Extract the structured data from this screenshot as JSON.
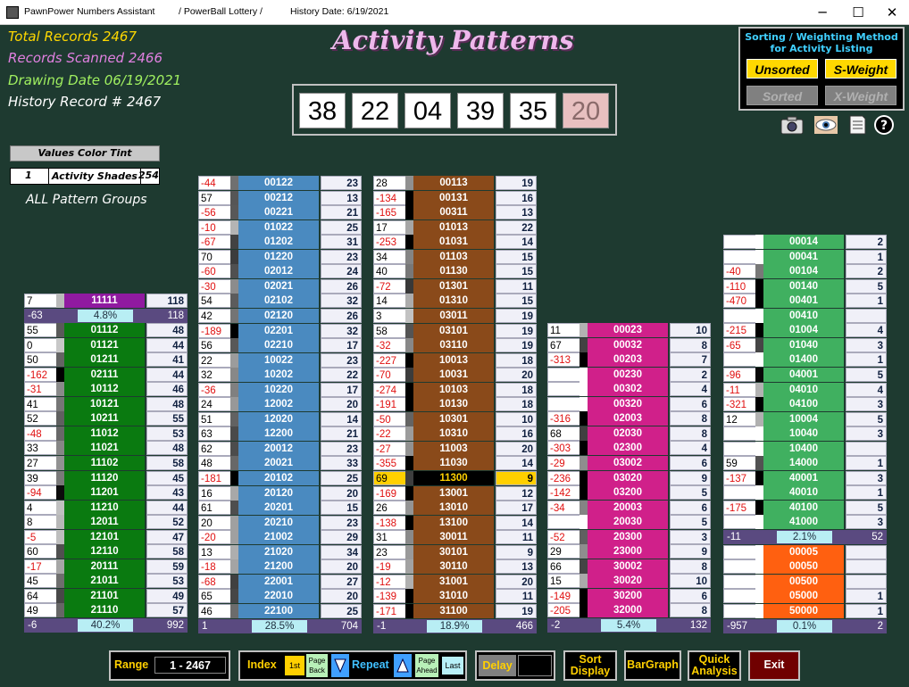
{
  "window": {
    "app": "PawnPower Numbers Assistant",
    "game": "/ PowerBall Lottery /",
    "history": "History Date:  6/19/2021",
    "minimize": "─",
    "maximize": "☐",
    "close": "✕"
  },
  "stats": {
    "total": "Total Records    2467",
    "scanned": "Records Scanned    2466",
    "drawing": "Drawing Date   06/19/2021",
    "history": "History Record #   2467"
  },
  "page_title": "Activity Patterns",
  "drawing": {
    "balls": [
      "38",
      "22",
      "04",
      "39",
      "35"
    ],
    "powerball": "20"
  },
  "sorting": {
    "header": "Sorting / Weighting Method for Activity Listing",
    "unsorted": "Unsorted",
    "sweight": "S-Weight",
    "sorted": "Sorted",
    "xweight": "X-Weight"
  },
  "tools": {
    "camera": "camera-icon",
    "eye": "eye-icon",
    "document": "document-icon",
    "help": "help-icon"
  },
  "tint": {
    "button": "Values Color Tint",
    "min": "1",
    "label": "Activity Shades",
    "max": "254"
  },
  "all_groups": "ALL Pattern Groups",
  "groups": [
    {
      "color": "#0a7a10",
      "header": {
        "l": "7",
        "m": "11111",
        "r": "118"
      },
      "headsum": {
        "l": "-63",
        "pct": "4.8%",
        "r": "118"
      },
      "rows": [
        [
          "55",
          "01112",
          "48"
        ],
        [
          "0",
          "01121",
          "44"
        ],
        [
          "50",
          "01211",
          "41"
        ],
        [
          "-162",
          "02111",
          "44"
        ],
        [
          "-31",
          "10112",
          "46"
        ],
        [
          "41",
          "10121",
          "48"
        ],
        [
          "52",
          "10211",
          "55"
        ],
        [
          "-48",
          "11012",
          "53"
        ],
        [
          "33",
          "11021",
          "48"
        ],
        [
          "27",
          "11102",
          "58"
        ],
        [
          "39",
          "11120",
          "45"
        ],
        [
          "-94",
          "11201",
          "43"
        ],
        [
          "4",
          "11210",
          "44"
        ],
        [
          "8",
          "12011",
          "52"
        ],
        [
          "-5",
          "12101",
          "47"
        ],
        [
          "60",
          "12110",
          "58"
        ],
        [
          "-17",
          "20111",
          "59"
        ],
        [
          "45",
          "21011",
          "53"
        ],
        [
          "64",
          "21101",
          "49"
        ],
        [
          "49",
          "21110",
          "57"
        ]
      ],
      "sum": {
        "l": "-6",
        "pct": "40.2%",
        "r": "992"
      }
    },
    {
      "color": "#4a8ac0",
      "rows": [
        [
          "-44",
          "00122",
          "23"
        ],
        [
          "57",
          "00212",
          "13"
        ],
        [
          "-56",
          "00221",
          "21"
        ],
        [
          "-10",
          "01022",
          "25"
        ],
        [
          "-67",
          "01202",
          "31"
        ],
        [
          "70",
          "01220",
          "23"
        ],
        [
          "-60",
          "02012",
          "24"
        ],
        [
          "-30",
          "02021",
          "26"
        ],
        [
          "54",
          "02102",
          "32"
        ],
        [
          "42",
          "02120",
          "26"
        ],
        [
          "-189",
          "02201",
          "32"
        ],
        [
          "56",
          "02210",
          "17"
        ],
        [
          "22",
          "10022",
          "23"
        ],
        [
          "32",
          "10202",
          "22"
        ],
        [
          "-36",
          "10220",
          "17"
        ],
        [
          "24",
          "12002",
          "20"
        ],
        [
          "51",
          "12020",
          "14"
        ],
        [
          "63",
          "12200",
          "21"
        ],
        [
          "62",
          "20012",
          "23"
        ],
        [
          "48",
          "20021",
          "33"
        ],
        [
          "-181",
          "20102",
          "25"
        ],
        [
          "16",
          "20120",
          "20"
        ],
        [
          "61",
          "20201",
          "15"
        ],
        [
          "20",
          "20210",
          "23"
        ],
        [
          "-20",
          "21002",
          "29"
        ],
        [
          "13",
          "21020",
          "34"
        ],
        [
          "-18",
          "21200",
          "20"
        ],
        [
          "-68",
          "22001",
          "27"
        ],
        [
          "65",
          "22010",
          "20"
        ],
        [
          "46",
          "22100",
          "25"
        ]
      ],
      "sum": {
        "l": "1",
        "pct": "28.5%",
        "r": "704"
      }
    },
    {
      "color": "#8a4a1a",
      "rows": [
        [
          "28",
          "00113",
          "19"
        ],
        [
          "-134",
          "00131",
          "16"
        ],
        [
          "-165",
          "00311",
          "13"
        ],
        [
          "17",
          "01013",
          "22"
        ],
        [
          "-253",
          "01031",
          "14"
        ],
        [
          "34",
          "01103",
          "15"
        ],
        [
          "40",
          "01130",
          "15"
        ],
        [
          "-72",
          "01301",
          "11"
        ],
        [
          "14",
          "01310",
          "15"
        ],
        [
          "3",
          "03011",
          "19"
        ],
        [
          "58",
          "03101",
          "19"
        ],
        [
          "-32",
          "03110",
          "19"
        ],
        [
          "-227",
          "10013",
          "18"
        ],
        [
          "-70",
          "10031",
          "20"
        ],
        [
          "-274",
          "10103",
          "18"
        ],
        [
          "-191",
          "10130",
          "18"
        ],
        [
          "-50",
          "10301",
          "10"
        ],
        [
          "-22",
          "10310",
          "16"
        ],
        [
          "-27",
          "11003",
          "20"
        ],
        [
          "-355",
          "11030",
          "14"
        ],
        [
          "69",
          "11300",
          "9"
        ],
        [
          "-169",
          "13001",
          "12"
        ],
        [
          "26",
          "13010",
          "17"
        ],
        [
          "-138",
          "13100",
          "14"
        ],
        [
          "31",
          "30011",
          "11"
        ],
        [
          "23",
          "30101",
          "9"
        ],
        [
          "-19",
          "30110",
          "13"
        ],
        [
          "-12",
          "31001",
          "20"
        ],
        [
          "-139",
          "31010",
          "11"
        ],
        [
          "-171",
          "31100",
          "19"
        ]
      ],
      "sum": {
        "l": "-1",
        "pct": "18.9%",
        "r": "466"
      }
    },
    {
      "color": "#d0208a",
      "rows": [
        [
          "11",
          "00023",
          "10"
        ],
        [
          "67",
          "00032",
          "8"
        ],
        [
          "-313",
          "00203",
          "7"
        ],
        [
          "",
          "00230",
          "2"
        ],
        [
          "",
          "00302",
          "4"
        ],
        [
          "",
          "00320",
          "6"
        ],
        [
          "-316",
          "02003",
          "8"
        ],
        [
          "68",
          "02030",
          "8"
        ],
        [
          "-303",
          "02300",
          "4"
        ],
        [
          "-29",
          "03002",
          "6"
        ],
        [
          "-236",
          "03020",
          "9"
        ],
        [
          "-142",
          "03200",
          "5"
        ],
        [
          "-34",
          "20003",
          "6"
        ],
        [
          "",
          "20030",
          "5"
        ],
        [
          "-52",
          "20300",
          "3"
        ],
        [
          "29",
          "23000",
          "9"
        ],
        [
          "66",
          "30002",
          "8"
        ],
        [
          "15",
          "30020",
          "10"
        ],
        [
          "-149",
          "30200",
          "6"
        ],
        [
          "-205",
          "32000",
          "8"
        ]
      ],
      "sum": {
        "l": "-2",
        "pct": "5.4%",
        "r": "132"
      }
    },
    {
      "color": "#40b060",
      "rows": [
        [
          "",
          "00014",
          "2"
        ],
        [
          "",
          "00041",
          "1"
        ],
        [
          "-40",
          "00104",
          "2"
        ],
        [
          "-110",
          "00140",
          "5"
        ],
        [
          "-470",
          "00401",
          "1"
        ],
        [
          "",
          "00410",
          ""
        ],
        [
          "-215",
          "01004",
          "4"
        ],
        [
          "-65",
          "01040",
          "3"
        ],
        [
          "",
          "01400",
          "1"
        ],
        [
          "-96",
          "04001",
          "5"
        ],
        [
          "-11",
          "04010",
          "4"
        ],
        [
          "-321",
          "04100",
          "3"
        ],
        [
          "12",
          "10004",
          "5"
        ],
        [
          "",
          "10040",
          "3"
        ],
        [
          "",
          "10400",
          ""
        ],
        [
          "59",
          "14000",
          "1"
        ],
        [
          "-137",
          "40001",
          "3"
        ],
        [
          "",
          "40010",
          "1"
        ],
        [
          "-175",
          "40100",
          "5"
        ],
        [
          "",
          "41000",
          "3"
        ]
      ],
      "sum": {
        "l": "-11",
        "pct": "2.1%",
        "r": "52"
      },
      "extra_color": "#ff6010",
      "extra": [
        [
          "",
          "00005",
          ""
        ],
        [
          "",
          "00050",
          ""
        ],
        [
          "",
          "00500",
          ""
        ],
        [
          "",
          "05000",
          "1"
        ],
        [
          "",
          "50000",
          "1"
        ]
      ],
      "extra_sum": {
        "l": "-957",
        "pct": "0.1%",
        "r": "2"
      }
    }
  ],
  "bottom": {
    "range_label": "Range",
    "range_value": "1 - 2467",
    "index": "Index",
    "first": "1st",
    "page_back": "Page Back",
    "repeat": "Repeat",
    "page_ahead": "Page Ahead",
    "last": "Last",
    "delay": "Delay",
    "sort_display": "Sort Display",
    "bargraph": "BarGraph",
    "quick_analysis": "Quick Analysis",
    "exit": "Exit"
  }
}
